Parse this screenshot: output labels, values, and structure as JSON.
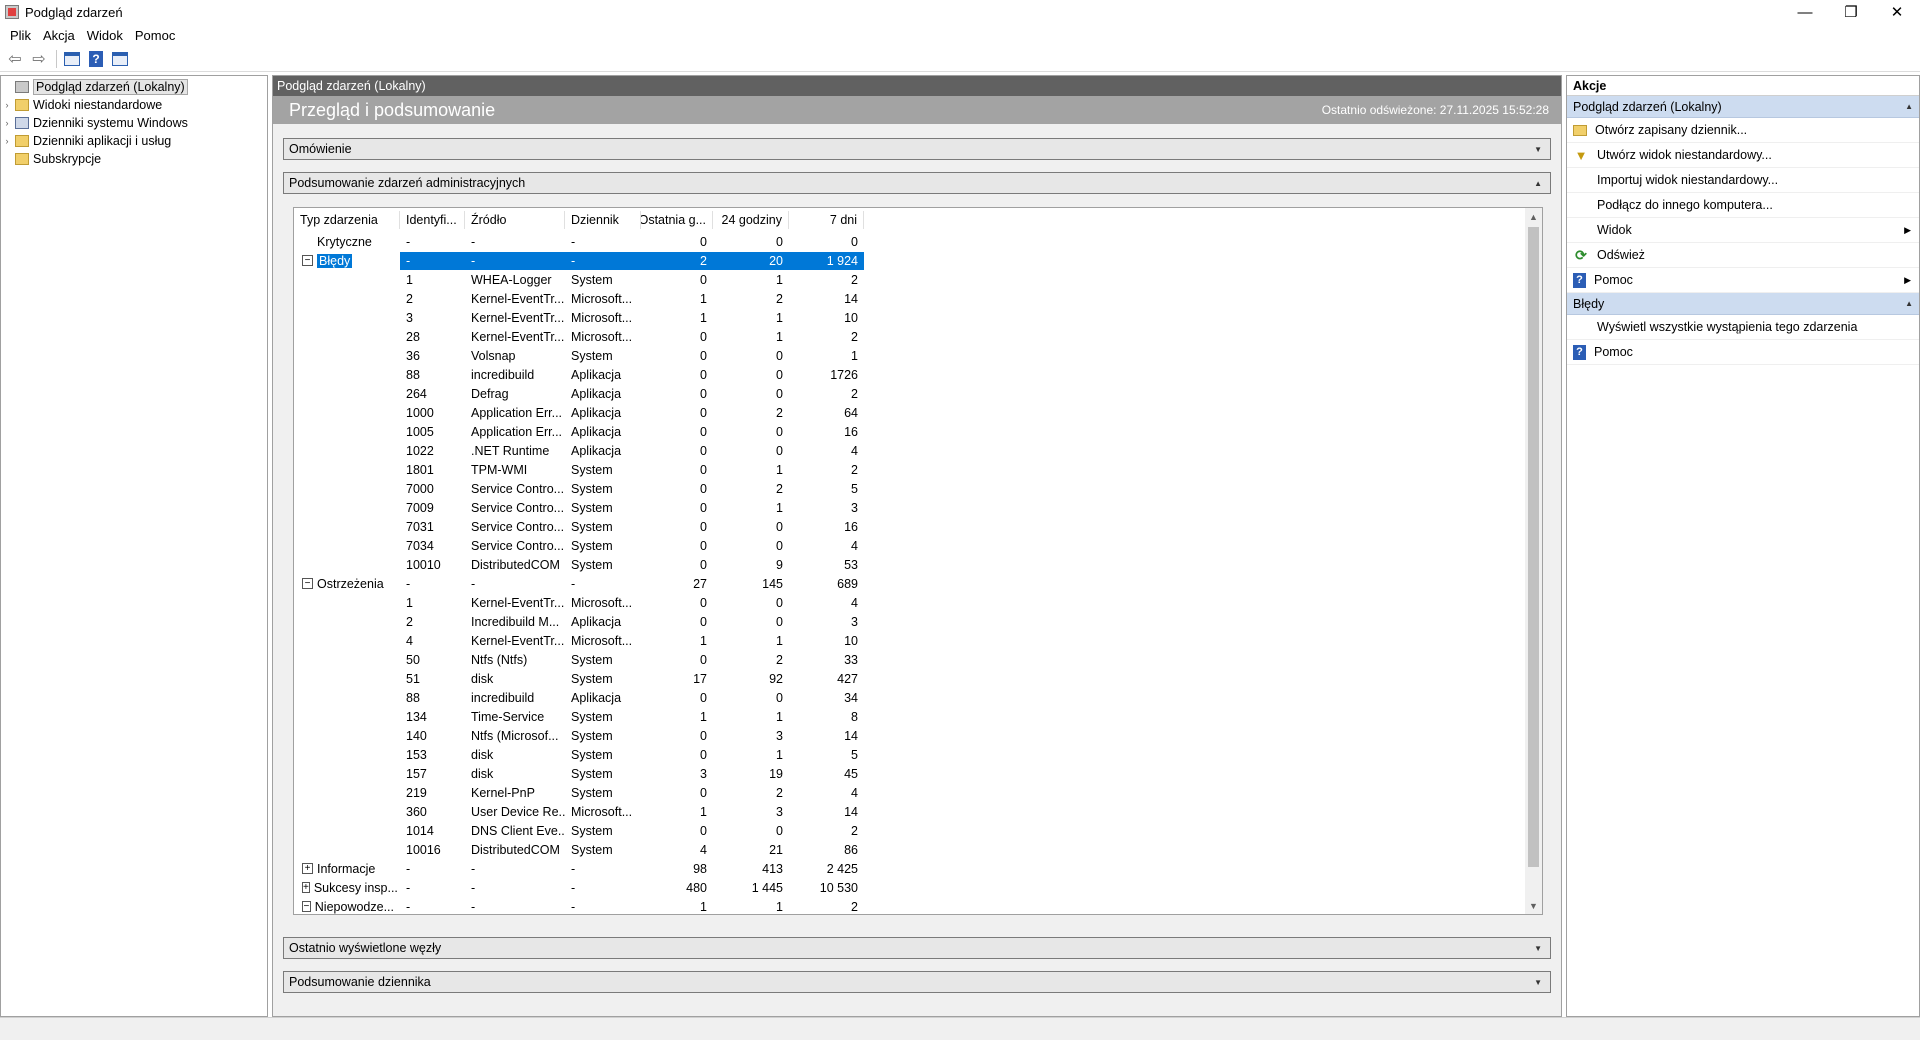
{
  "window": {
    "title": "Podgląd zdarzeń",
    "controls": [
      "—",
      "❐",
      "✕"
    ]
  },
  "menu": [
    "Plik",
    "Akcja",
    "Widok",
    "Pomoc"
  ],
  "tree": [
    {
      "label": "Podgląd zdarzeń (Lokalny)",
      "expander": "",
      "icon": "root",
      "selected": true
    },
    {
      "label": "Widoki niestandardowe",
      "expander": "›",
      "icon": "folder"
    },
    {
      "label": "Dzienniki systemu Windows",
      "expander": "›",
      "icon": "log"
    },
    {
      "label": "Dzienniki aplikacji i usług",
      "expander": "›",
      "icon": "folder"
    },
    {
      "label": "Subskrypcje",
      "expander": "",
      "icon": "folder"
    }
  ],
  "center": {
    "header": "Podgląd zdarzeń (Lokalny)",
    "banner_title": "Przegląd i podsumowanie",
    "refreshed": "Ostatnio odświeżone: 27.11.2025 15:52:28",
    "sections": {
      "overview": "Omówienie",
      "summary": "Podsumowanie zdarzeń administracyjnych",
      "recent": "Ostatnio wyświetlone węzły",
      "log_summary": "Podsumowanie dziennika"
    },
    "columns": [
      "Typ zdarzenia",
      "Identyfi...",
      "Źródło",
      "Dziennik",
      "Ostatnia g...",
      "24 godziny",
      "7 dni"
    ],
    "rows": [
      {
        "type": "Krytyczne",
        "exp": "",
        "id": "-",
        "src": "-",
        "log": "-",
        "last": "0",
        "h24": "0",
        "d7": "0"
      },
      {
        "type": "Błędy",
        "exp": "−",
        "id": "-",
        "src": "-",
        "log": "-",
        "last": "2",
        "h24": "20",
        "d7": "1 924",
        "selected": true
      },
      {
        "type": "",
        "id": "1",
        "src": "WHEA-Logger",
        "log": "System",
        "last": "0",
        "h24": "1",
        "d7": "2"
      },
      {
        "type": "",
        "id": "2",
        "src": "Kernel-EventTr...",
        "log": "Microsoft...",
        "last": "1",
        "h24": "2",
        "d7": "14"
      },
      {
        "type": "",
        "id": "3",
        "src": "Kernel-EventTr...",
        "log": "Microsoft...",
        "last": "1",
        "h24": "1",
        "d7": "10"
      },
      {
        "type": "",
        "id": "28",
        "src": "Kernel-EventTr...",
        "log": "Microsoft...",
        "last": "0",
        "h24": "1",
        "d7": "2"
      },
      {
        "type": "",
        "id": "36",
        "src": "Volsnap",
        "log": "System",
        "last": "0",
        "h24": "0",
        "d7": "1"
      },
      {
        "type": "",
        "id": "88",
        "src": "incredibuild",
        "log": "Aplikacja",
        "last": "0",
        "h24": "0",
        "d7": "1726"
      },
      {
        "type": "",
        "id": "264",
        "src": "Defrag",
        "log": "Aplikacja",
        "last": "0",
        "h24": "0",
        "d7": "2"
      },
      {
        "type": "",
        "id": "1000",
        "src": "Application Err...",
        "log": "Aplikacja",
        "last": "0",
        "h24": "2",
        "d7": "64"
      },
      {
        "type": "",
        "id": "1005",
        "src": "Application Err...",
        "log": "Aplikacja",
        "last": "0",
        "h24": "0",
        "d7": "16"
      },
      {
        "type": "",
        "id": "1022",
        "src": ".NET Runtime",
        "log": "Aplikacja",
        "last": "0",
        "h24": "0",
        "d7": "4"
      },
      {
        "type": "",
        "id": "1801",
        "src": "TPM-WMI",
        "log": "System",
        "last": "0",
        "h24": "1",
        "d7": "2"
      },
      {
        "type": "",
        "id": "7000",
        "src": "Service Contro...",
        "log": "System",
        "last": "0",
        "h24": "2",
        "d7": "5"
      },
      {
        "type": "",
        "id": "7009",
        "src": "Service Contro...",
        "log": "System",
        "last": "0",
        "h24": "1",
        "d7": "3"
      },
      {
        "type": "",
        "id": "7031",
        "src": "Service Contro...",
        "log": "System",
        "last": "0",
        "h24": "0",
        "d7": "16"
      },
      {
        "type": "",
        "id": "7034",
        "src": "Service Contro...",
        "log": "System",
        "last": "0",
        "h24": "0",
        "d7": "4"
      },
      {
        "type": "",
        "id": "10010",
        "src": "DistributedCOM",
        "log": "System",
        "last": "0",
        "h24": "9",
        "d7": "53"
      },
      {
        "type": "Ostrzeżenia",
        "exp": "−",
        "id": "-",
        "src": "-",
        "log": "-",
        "last": "27",
        "h24": "145",
        "d7": "689"
      },
      {
        "type": "",
        "id": "1",
        "src": "Kernel-EventTr...",
        "log": "Microsoft...",
        "last": "0",
        "h24": "0",
        "d7": "4"
      },
      {
        "type": "",
        "id": "2",
        "src": "Incredibuild M...",
        "log": "Aplikacja",
        "last": "0",
        "h24": "0",
        "d7": "3"
      },
      {
        "type": "",
        "id": "4",
        "src": "Kernel-EventTr...",
        "log": "Microsoft...",
        "last": "1",
        "h24": "1",
        "d7": "10"
      },
      {
        "type": "",
        "id": "50",
        "src": "Ntfs (Ntfs)",
        "log": "System",
        "last": "0",
        "h24": "2",
        "d7": "33"
      },
      {
        "type": "",
        "id": "51",
        "src": "disk",
        "log": "System",
        "last": "17",
        "h24": "92",
        "d7": "427"
      },
      {
        "type": "",
        "id": "88",
        "src": "incredibuild",
        "log": "Aplikacja",
        "last": "0",
        "h24": "0",
        "d7": "34"
      },
      {
        "type": "",
        "id": "134",
        "src": "Time-Service",
        "log": "System",
        "last": "1",
        "h24": "1",
        "d7": "8"
      },
      {
        "type": "",
        "id": "140",
        "src": "Ntfs (Microsof...",
        "log": "System",
        "last": "0",
        "h24": "3",
        "d7": "14"
      },
      {
        "type": "",
        "id": "153",
        "src": "disk",
        "log": "System",
        "last": "0",
        "h24": "1",
        "d7": "5"
      },
      {
        "type": "",
        "id": "157",
        "src": "disk",
        "log": "System",
        "last": "3",
        "h24": "19",
        "d7": "45"
      },
      {
        "type": "",
        "id": "219",
        "src": "Kernel-PnP",
        "log": "System",
        "last": "0",
        "h24": "2",
        "d7": "4"
      },
      {
        "type": "",
        "id": "360",
        "src": "User Device Re...",
        "log": "Microsoft...",
        "last": "1",
        "h24": "3",
        "d7": "14"
      },
      {
        "type": "",
        "id": "1014",
        "src": "DNS Client Eve...",
        "log": "System",
        "last": "0",
        "h24": "0",
        "d7": "2"
      },
      {
        "type": "",
        "id": "10016",
        "src": "DistributedCOM",
        "log": "System",
        "last": "4",
        "h24": "21",
        "d7": "86"
      },
      {
        "type": "Informacje",
        "exp": "+",
        "id": "-",
        "src": "-",
        "log": "-",
        "last": "98",
        "h24": "413",
        "d7": "2 425"
      },
      {
        "type": "Sukcesy insp...",
        "exp": "+",
        "id": "-",
        "src": "-",
        "log": "-",
        "last": "480",
        "h24": "1 445",
        "d7": "10 530"
      },
      {
        "type": "Niepowodze...",
        "exp": "−",
        "id": "-",
        "src": "-",
        "log": "-",
        "last": "1",
        "h24": "1",
        "d7": "2"
      }
    ]
  },
  "actions": {
    "title": "Akcje",
    "group1": "Podgląd zdarzeń (Lokalny)",
    "items1": [
      {
        "label": "Otwórz zapisany dziennik...",
        "icon": "folder-icon",
        "cls": "ai-folder",
        "glyph": ""
      },
      {
        "label": "Utwórz widok niestandardowy...",
        "icon": "filter-icon",
        "cls": "ai-filter",
        "glyph": "▼"
      },
      {
        "label": "Importuj widok niestandardowy...",
        "icon": "blank-icon",
        "cls": "ai-blank",
        "glyph": ""
      },
      {
        "label": "Podłącz do innego komputera...",
        "icon": "blank-icon",
        "cls": "ai-blank",
        "glyph": ""
      },
      {
        "label": "Widok",
        "icon": "blank-icon",
        "cls": "ai-blank",
        "glyph": "",
        "submenu": true
      },
      {
        "label": "Odśwież",
        "icon": "refresh-icon",
        "cls": "ai-refresh",
        "glyph": "⟳"
      },
      {
        "label": "Pomoc",
        "icon": "help-icon",
        "cls": "ai-help",
        "glyph": "?",
        "submenu": true
      }
    ],
    "group2": "Błędy",
    "items2": [
      {
        "label": "Wyświetl wszystkie wystąpienia tego zdarzenia",
        "icon": "blank-icon",
        "cls": "ai-blank",
        "glyph": ""
      },
      {
        "label": "Pomoc",
        "icon": "help-icon",
        "cls": "ai-help",
        "glyph": "?"
      }
    ]
  }
}
